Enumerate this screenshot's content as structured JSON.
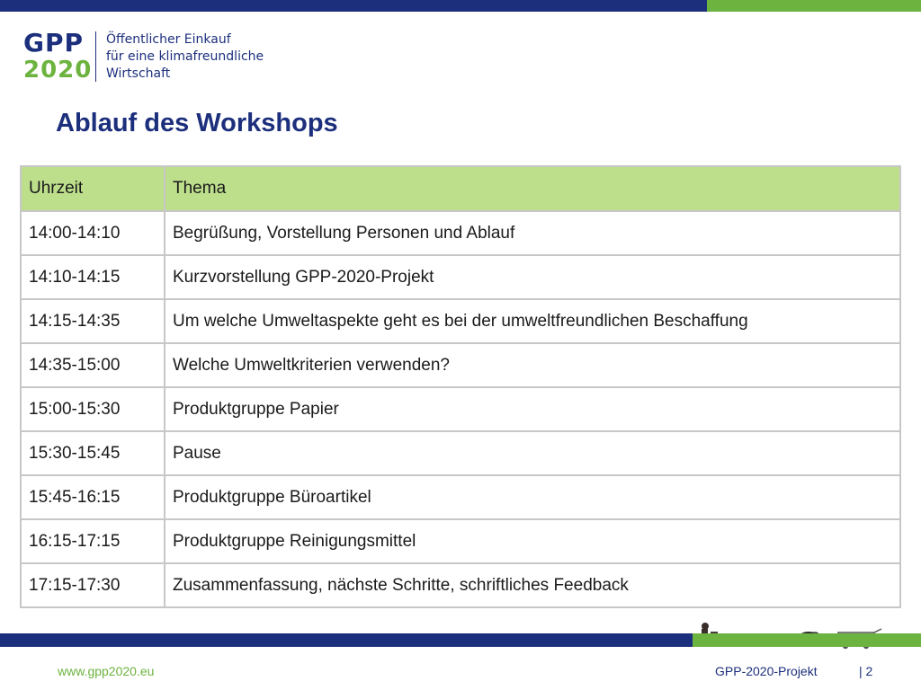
{
  "header": {
    "logo": {
      "mark_top": "GPP",
      "mark_bottom": "2020",
      "tagline": [
        "Öffentlicher Einkauf",
        "für eine klimafreundliche",
        "Wirtschaft"
      ]
    },
    "colors": {
      "brand_blue": "#1c2f7c",
      "brand_green": "#6db33f",
      "table_header": "#bddf8c"
    }
  },
  "slide": {
    "title": "Ablauf des Workshops"
  },
  "table": {
    "headers": [
      "Uhrzeit",
      "Thema"
    ],
    "rows": [
      [
        "14:00-14:10",
        "Begrüßung, Vorstellung Personen und Ablauf"
      ],
      [
        "14:10-14:15",
        "Kurzvorstellung GPP-2020-Projekt"
      ],
      [
        "14:15-14:35",
        "Um welche Umweltaspekte geht es bei der umweltfreundlichen Beschaffung"
      ],
      [
        "14:35-15:00",
        "Welche Umweltkriterien verwenden?"
      ],
      [
        "15:00-15:30",
        "Produktgruppe Papier"
      ],
      [
        "15:30-15:45",
        "Pause"
      ],
      [
        "15:45-16:15",
        "Produktgruppe Büroartikel"
      ],
      [
        "16:15-17:15",
        "Produktgruppe Reinigungsmittel"
      ],
      [
        "17:15-17:30",
        "Zusammenfassung, nächste Schritte, schriftliches Feedback"
      ]
    ]
  },
  "footer": {
    "website": "www.gpp2020.eu",
    "project": "GPP-2020-Projekt",
    "page": "| 2"
  }
}
